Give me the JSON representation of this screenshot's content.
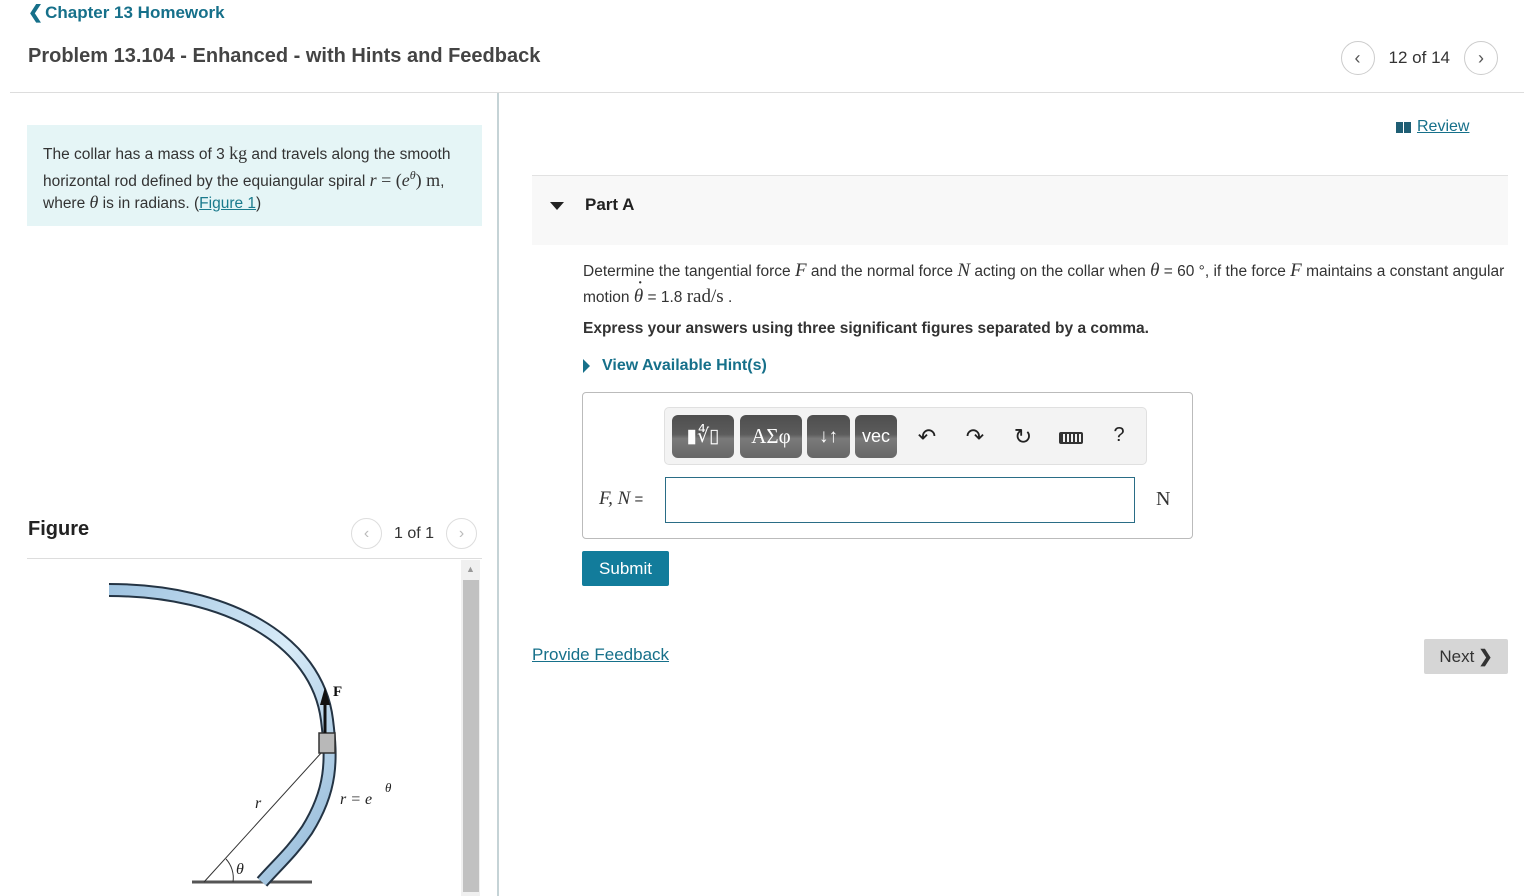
{
  "nav": {
    "back_label": "Chapter 13 Homework",
    "problem_title": "Problem 13.104 - Enhanced - with Hints and Feedback",
    "pager_text": "12 of 14"
  },
  "intro": {
    "text_1": "The collar has a mass of 3 ",
    "mass_unit": "kg",
    "text_2": " and travels along the smooth horizontal rod defined by the equiangular spiral ",
    "equation": "r = (e^θ) m",
    "text_3": ", where ",
    "theta": "θ",
    "text_4": " is in radians. (",
    "figure_link": "Figure 1",
    "text_5": ")"
  },
  "figure": {
    "title": "Figure",
    "pager_text": "1 of 1",
    "labels": {
      "force": "F",
      "radius": "r",
      "angle": "θ",
      "curve_eq": "r = e"
    }
  },
  "review": {
    "label": "Review"
  },
  "part": {
    "title": "Part A",
    "question_1": "Determine the tangential force ",
    "F": "F",
    "question_2": " and the normal force ",
    "N": "N",
    "question_3": " acting on the collar when ",
    "theta": "θ",
    "question_4": " = 60 °, if the force ",
    "question_5": " maintains a constant angular motion ",
    "question_6": " = 1.8 ",
    "rate_unit": "rad/s",
    "question_7": " .",
    "express": "Express your answers using three significant figures separated by a comma.",
    "hint_label": "View Available Hint(s)"
  },
  "answer": {
    "toolbar": {
      "templates": "▮∜▯",
      "greek": "ΑΣφ",
      "arrows": "↓↑",
      "vec": "vec",
      "undo": "↶",
      "redo": "↷",
      "reset": "↻",
      "help": "?"
    },
    "label_vars": "F, N",
    "label_eq": " =",
    "value": "",
    "unit": "N"
  },
  "actions": {
    "submit": "Submit",
    "feedback": "Provide Feedback",
    "next": "Next"
  }
}
